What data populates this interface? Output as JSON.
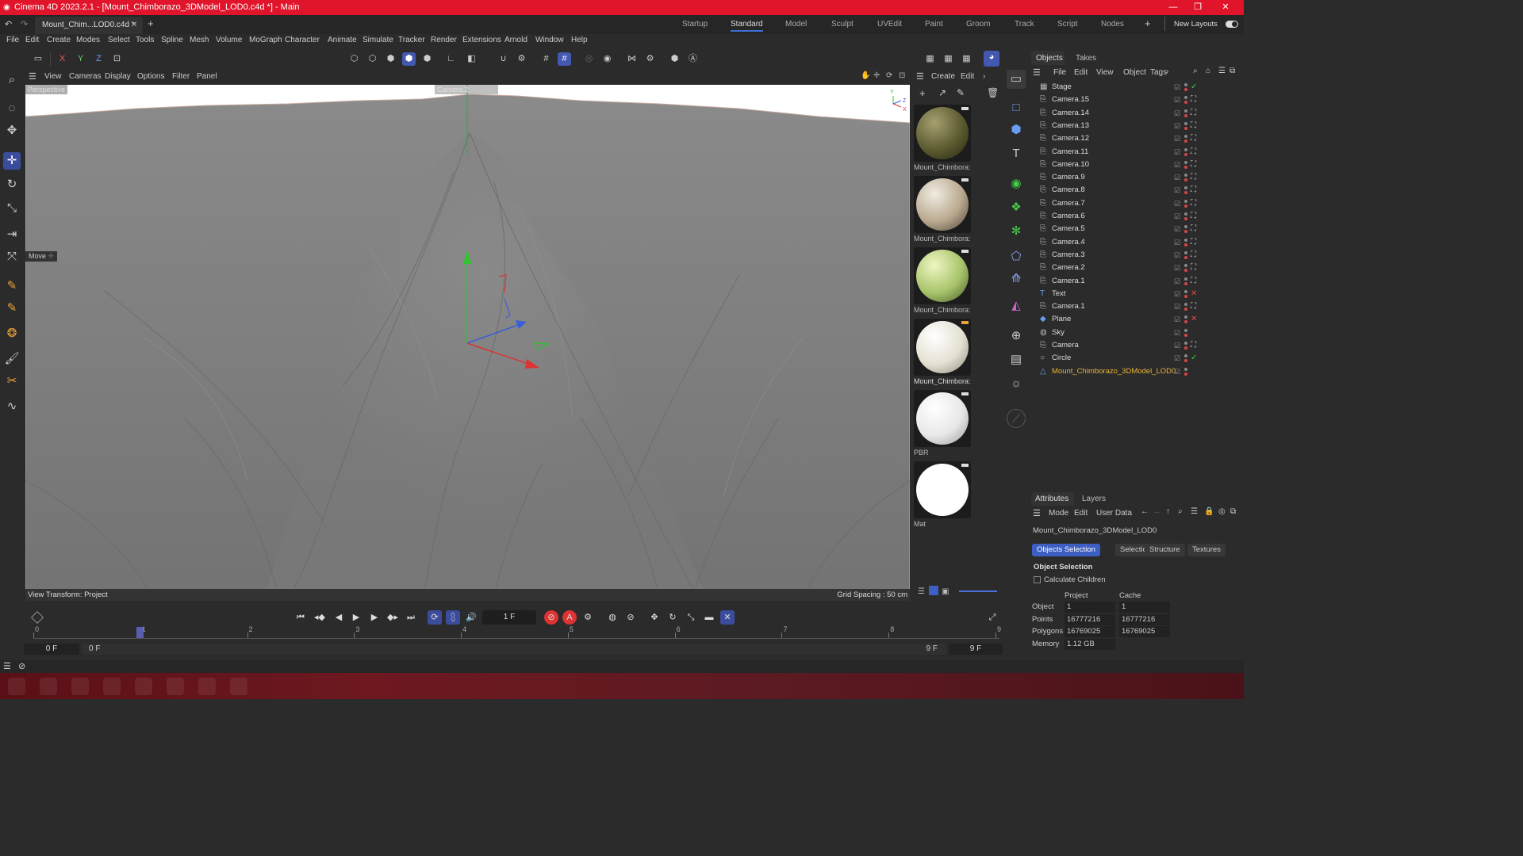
{
  "window": {
    "title": "Cinema 4D 2023.2.1 - [Mount_Chimborazo_3DModel_LOD0.c4d *] - Main",
    "controls": [
      "—",
      "❐",
      "✕"
    ]
  },
  "tabs": {
    "document": "Mount_Chim...LOD0.c4d *",
    "close": "✕",
    "add": "+",
    "layouts": [
      "Startup",
      "Standard",
      "Model",
      "Sculpt",
      "UVEdit",
      "Paint",
      "Groom",
      "Track",
      "Script",
      "Nodes"
    ],
    "active_layout": "Standard",
    "new_layouts": "New Layouts"
  },
  "menu": [
    "File",
    "Edit",
    "Create",
    "Modes",
    "Select",
    "Tools",
    "Spline",
    "Mesh",
    "Volume",
    "MoGraph",
    "Character",
    "Animate",
    "Simulate",
    "Tracker",
    "Render",
    "Extensions",
    "Arnold",
    "Window",
    "Help"
  ],
  "toolbar": {
    "axis_labels": [
      "X",
      "Y",
      "Z"
    ]
  },
  "viewport": {
    "menu": [
      "View",
      "Cameras",
      "Display",
      "Options",
      "Filter",
      "Panel"
    ],
    "view_name": "Perspective",
    "camera_name": "Camera.2",
    "tool_label": "Move",
    "view_transform": "View Transform: Project",
    "grid_spacing": "Grid Spacing : 50 cm",
    "colors": {
      "sky": "#ffffff",
      "terrain": "#7a7a7a",
      "x_axis": "#d33",
      "y_axis": "#2c2",
      "z_axis": "#36d"
    }
  },
  "materials": {
    "menu": [
      "Create",
      "Edit"
    ],
    "items": [
      {
        "name": "Mount_Chimbora:",
        "color": "#5b5a30",
        "selected": false
      },
      {
        "name": "Mount_Chimbora:",
        "color": "#b9a98f",
        "selected": false
      },
      {
        "name": "Mount_Chimbora:",
        "color": "#a8c46a",
        "selected": false
      },
      {
        "name": "Mount_Chimbora:",
        "color": "#e4e0d2",
        "selected": true
      },
      {
        "name": "PBR",
        "color": "#e8e8e8",
        "selected": false
      },
      {
        "name": "Mat",
        "color": "#ffffff",
        "selected": false
      }
    ]
  },
  "objects": {
    "tabs": [
      "Objects",
      "Takes"
    ],
    "menu": [
      "File",
      "Edit",
      "View",
      "Object",
      "Tags"
    ],
    "items": [
      {
        "name": "Stage",
        "icon": "stage-icon"
      },
      {
        "name": "Camera.15",
        "icon": "camera-icon"
      },
      {
        "name": "Camera.14",
        "icon": "camera-icon"
      },
      {
        "name": "Camera.13",
        "icon": "camera-icon"
      },
      {
        "name": "Camera.12",
        "icon": "camera-icon"
      },
      {
        "name": "Camera.11",
        "icon": "camera-icon"
      },
      {
        "name": "Camera.10",
        "icon": "camera-icon"
      },
      {
        "name": "Camera.9",
        "icon": "camera-icon"
      },
      {
        "name": "Camera.8",
        "icon": "camera-icon"
      },
      {
        "name": "Camera.7",
        "icon": "camera-icon"
      },
      {
        "name": "Camera.6",
        "icon": "camera-icon"
      },
      {
        "name": "Camera.5",
        "icon": "camera-icon"
      },
      {
        "name": "Camera.4",
        "icon": "camera-icon"
      },
      {
        "name": "Camera.3",
        "icon": "camera-icon"
      },
      {
        "name": "Camera.2",
        "icon": "camera-icon"
      },
      {
        "name": "Camera.1",
        "icon": "camera-icon"
      },
      {
        "name": "Text",
        "icon": "text-icon"
      },
      {
        "name": "Camera.1",
        "icon": "camera-icon"
      },
      {
        "name": "Plane",
        "icon": "plane-icon"
      },
      {
        "name": "Sky",
        "icon": "sky-icon"
      },
      {
        "name": "Camera",
        "icon": "camera-icon"
      },
      {
        "name": "Circle",
        "icon": "circle-icon"
      },
      {
        "name": "Mount_Chimborazo_3DModel_LOD0",
        "icon": "polygon-object-icon",
        "selected": true
      }
    ]
  },
  "attributes": {
    "tabs": [
      "Attributes",
      "Layers"
    ],
    "menu": [
      "Mode",
      "Edit",
      "User Data"
    ],
    "object_name": "Mount_Chimborazo_3DModel_LOD0",
    "sub_tabs": [
      "Objects Selection",
      "Selection",
      "Structure",
      "Textures"
    ],
    "active_sub_tab": "Objects Selection",
    "section_title": "Object Selection",
    "calc_children": "Calculate Children",
    "col_project": "Project",
    "col_cache": "Cache",
    "rows": [
      {
        "label": "Object",
        "project": "1",
        "cache": "1"
      },
      {
        "label": "Points",
        "project": "16777216",
        "cache": "16777216"
      },
      {
        "label": "Polygons",
        "project": "16769025",
        "cache": "16769025"
      },
      {
        "label": "Memory",
        "project": "1.12 GB",
        "cache": ""
      }
    ]
  },
  "timeline": {
    "current_frame": "1 F",
    "ticks": [
      "0",
      "1",
      "2",
      "3",
      "4",
      "5",
      "6",
      "7",
      "8",
      "9"
    ],
    "start": "0 F",
    "range_start": "0 F",
    "range_end": "9 F",
    "end": "9 F"
  }
}
